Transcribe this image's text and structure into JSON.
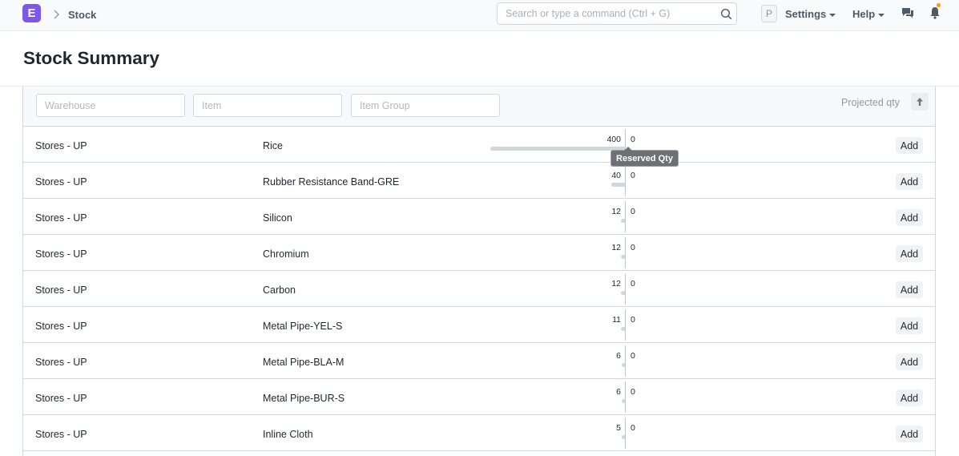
{
  "navbar": {
    "logo_letter": "E",
    "breadcrumb": "Stock",
    "search_placeholder": "Search or type a command (Ctrl + G)",
    "avatar_letter": "P",
    "settings_label": "Settings",
    "help_label": "Help",
    "colors": {
      "logo": "#7c57e8",
      "notification_dot": "#f29b0e"
    }
  },
  "page": {
    "title": "Stock Summary"
  },
  "filters": {
    "warehouse_placeholder": "Warehouse",
    "item_placeholder": "Item",
    "item_group_placeholder": "Item Group",
    "sort_label": "Projected qty"
  },
  "tooltip": "Reserved Qty",
  "rows": [
    {
      "warehouse": "Stores - UP",
      "item": "Rice",
      "qty_left": "400",
      "qty_right": "0",
      "bar_value": 400,
      "action": "Add"
    },
    {
      "warehouse": "Stores - UP",
      "item": "Rubber Resistance Band-GRE",
      "qty_left": "40",
      "qty_right": "0",
      "bar_value": 40,
      "action": "Add"
    },
    {
      "warehouse": "Stores - UP",
      "item": "Silicon",
      "qty_left": "12",
      "qty_right": "0",
      "bar_value": 12,
      "action": "Add"
    },
    {
      "warehouse": "Stores - UP",
      "item": "Chromium",
      "qty_left": "12",
      "qty_right": "0",
      "bar_value": 12,
      "action": "Add"
    },
    {
      "warehouse": "Stores - UP",
      "item": "Carbon",
      "qty_left": "12",
      "qty_right": "0",
      "bar_value": 12,
      "action": "Add"
    },
    {
      "warehouse": "Stores - UP",
      "item": "Metal Pipe-YEL-S",
      "qty_left": "11",
      "qty_right": "0",
      "bar_value": 11,
      "action": "Add"
    },
    {
      "warehouse": "Stores - UP",
      "item": "Metal Pipe-BLA-M",
      "qty_left": "6",
      "qty_right": "0",
      "bar_value": 6,
      "action": "Add"
    },
    {
      "warehouse": "Stores - UP",
      "item": "Metal Pipe-BUR-S",
      "qty_left": "6",
      "qty_right": "0",
      "bar_value": 6,
      "action": "Add"
    },
    {
      "warehouse": "Stores - UP",
      "item": "Inline Cloth",
      "qty_left": "5",
      "qty_right": "0",
      "bar_value": 5,
      "action": "Add"
    }
  ]
}
